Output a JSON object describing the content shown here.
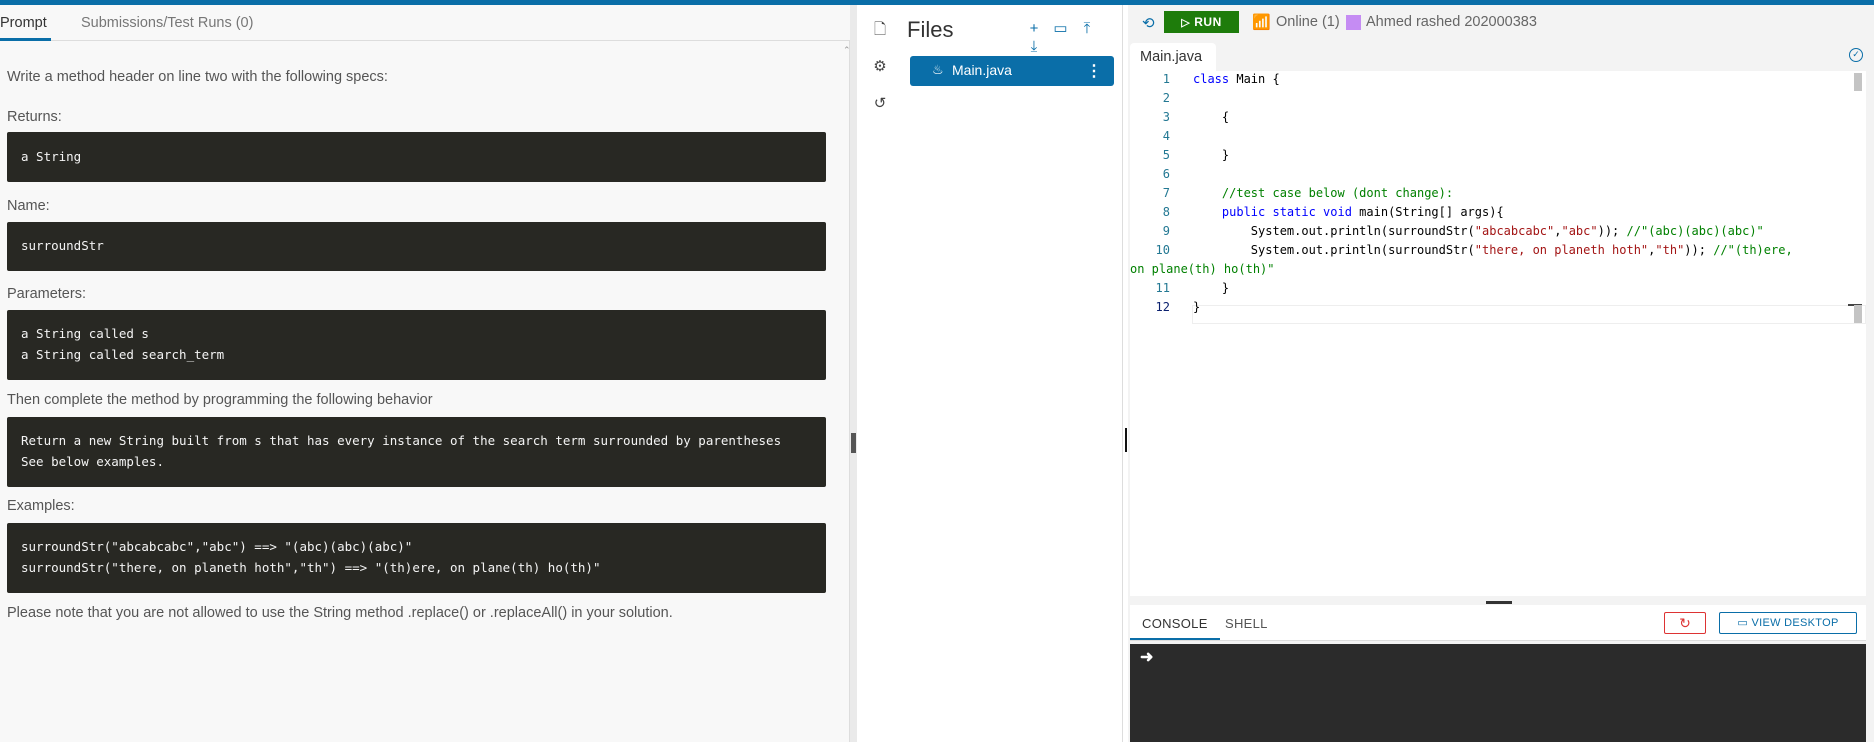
{
  "tabs": {
    "prompt": "Prompt",
    "submissions": "Submissions/Test Runs (0)"
  },
  "prompt": {
    "intro": "Write a method header on line two with the following specs:",
    "returns_label": "Returns:",
    "returns_code": [
      "a String"
    ],
    "name_label": "Name:",
    "name_code": [
      "surroundStr"
    ],
    "params_label": "Parameters:",
    "params_code": [
      "a String called s",
      "a String called search_term"
    ],
    "behavior_label": "Then complete the method by programming the following behavior",
    "behavior_code": [
      "Return a new String built from s that has every instance of the search term surrounded by parentheses",
      "See below examples."
    ],
    "examples_label": "Examples:",
    "examples_code": [
      "surroundStr(\"abcabcabc\",\"abc\") ==> \"(abc)(abc)(abc)\"",
      "surroundStr(\"there, on planeth hoth\",\"th\") ==> \"(th)ere, on plane(th) ho(th)\""
    ],
    "note": "Please note that you are not allowed to use the String method .replace() or .replaceAll() in your solution."
  },
  "files_panel": {
    "title": "Files",
    "file_name": "Main.java"
  },
  "runbar": {
    "run_label": "RUN",
    "online": "Online (1)",
    "user": "Ahmed rashed 202000383",
    "user_color": "#c58cf3"
  },
  "editor": {
    "tab_name": "Main.java",
    "line_numbers": [
      "1",
      "2",
      "3",
      "4",
      "5",
      "6",
      "7",
      "8",
      "9",
      "10",
      "",
      "11",
      "12"
    ],
    "code_lines": {
      "l1_kw": "class",
      "l1_rest": " Main {",
      "l3": "    {",
      "l5": "    }",
      "l7": "    //test case below (dont change):",
      "l8_kw": "    public static void",
      "l8_rest": " main(String[] args){",
      "l9_a": "        System.out.println(surroundStr(",
      "l9_s1": "\"abcabcabc\"",
      "l9_b": ",",
      "l9_s2": "\"abc\"",
      "l9_c": ")); ",
      "l9_cm": "//\"(abc)(abc)(abc)\"",
      "l10_a": "        System.out.println(surroundStr(",
      "l10_s1": "\"there, on planeth hoth\"",
      "l10_b": ",",
      "l10_s2": "\"th\"",
      "l10_c": ")); ",
      "l10_cm": "//\"(th)ere,",
      "l10_wrap": "on plane(th) ho(th)\"",
      "l11": "    }",
      "l12": "}"
    }
  },
  "console": {
    "tab_console": "CONSOLE",
    "tab_shell": "SHELL",
    "desktop_label": "VIEW DESKTOP",
    "prompt_symbol": "➜"
  },
  "colors": {
    "accent": "#0a6ea8",
    "run_green": "#1e7c0b",
    "code_bg": "#282823"
  }
}
